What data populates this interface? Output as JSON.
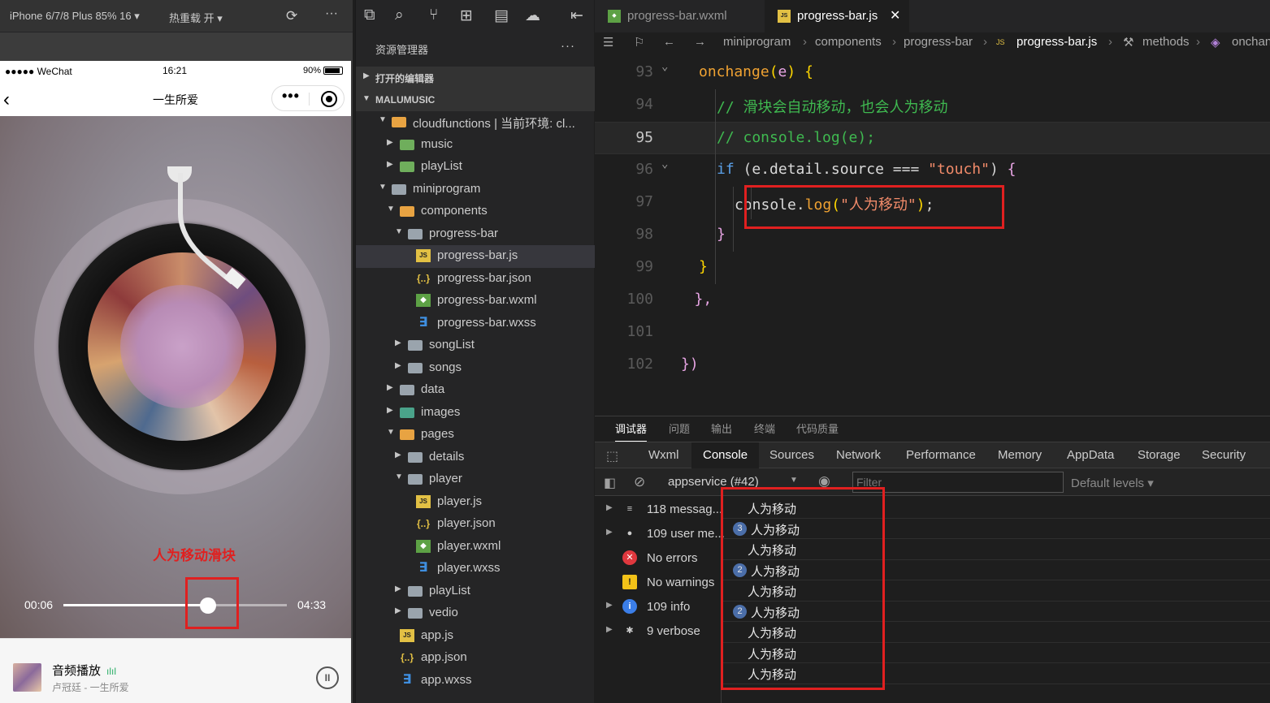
{
  "simulator": {
    "device": "iPhone 6/7/8 Plus 85% 16 ▾",
    "hot_reload": "热重载 开 ▾",
    "refresh_icon": "refresh-icon",
    "more_icon": "···",
    "status": {
      "signal": "●●●●● WeChat",
      "time": "16:21",
      "battery": "90%"
    },
    "nav": {
      "back": "‹",
      "title": "一生所爱",
      "more": "•••"
    },
    "player": {
      "drag_label": "人为移动滑块",
      "current_time": "00:06",
      "total_time": "04:33",
      "progress": 0.67
    },
    "controls": {
      "prev": "⏮",
      "next": "⏭",
      "list": "☰"
    },
    "mini": {
      "title": "音频播放",
      "eq": "ılıl",
      "subtitle": "卢冠廷 - 一生所爱",
      "pause": "II"
    }
  },
  "explorer": {
    "title": "资源管理器",
    "more": "···",
    "open_editors": "打开的编辑器",
    "project": "MALUMUSIC",
    "tree": [
      {
        "label": "cloudfunctions | 当前环境: cl...",
        "depth": 1,
        "arrow": "open",
        "icon": "folder-orange"
      },
      {
        "label": "music",
        "depth": 2,
        "arrow": "closed",
        "icon": "folder-green"
      },
      {
        "label": "playList",
        "depth": 2,
        "arrow": "closed",
        "icon": "folder-green"
      },
      {
        "label": "miniprogram",
        "depth": 1,
        "arrow": "open",
        "icon": "folder"
      },
      {
        "label": "components",
        "depth": 2,
        "arrow": "open",
        "icon": "folder-orange"
      },
      {
        "label": "progress-bar",
        "depth": 3,
        "arrow": "open",
        "icon": "folder"
      },
      {
        "label": "progress-bar.js",
        "depth": 4,
        "arrow": "",
        "icon": "js",
        "selected": true
      },
      {
        "label": "progress-bar.json",
        "depth": 4,
        "arrow": "",
        "icon": "json"
      },
      {
        "label": "progress-bar.wxml",
        "depth": 4,
        "arrow": "",
        "icon": "wxml"
      },
      {
        "label": "progress-bar.wxss",
        "depth": 4,
        "arrow": "",
        "icon": "wxss"
      },
      {
        "label": "songList",
        "depth": 3,
        "arrow": "closed",
        "icon": "folder"
      },
      {
        "label": "songs",
        "depth": 3,
        "arrow": "closed",
        "icon": "folder"
      },
      {
        "label": "data",
        "depth": 2,
        "arrow": "closed",
        "icon": "folder"
      },
      {
        "label": "images",
        "depth": 2,
        "arrow": "closed",
        "icon": "folder-teal"
      },
      {
        "label": "pages",
        "depth": 2,
        "arrow": "open",
        "icon": "folder-orange"
      },
      {
        "label": "details",
        "depth": 3,
        "arrow": "closed",
        "icon": "folder"
      },
      {
        "label": "player",
        "depth": 3,
        "arrow": "open",
        "icon": "folder"
      },
      {
        "label": "player.js",
        "depth": 4,
        "arrow": "",
        "icon": "js"
      },
      {
        "label": "player.json",
        "depth": 4,
        "arrow": "",
        "icon": "json"
      },
      {
        "label": "player.wxml",
        "depth": 4,
        "arrow": "",
        "icon": "wxml"
      },
      {
        "label": "player.wxss",
        "depth": 4,
        "arrow": "",
        "icon": "wxss"
      },
      {
        "label": "playList",
        "depth": 3,
        "arrow": "closed",
        "icon": "folder"
      },
      {
        "label": "vedio",
        "depth": 3,
        "arrow": "closed",
        "icon": "folder"
      },
      {
        "label": "app.js",
        "depth": 2,
        "arrow": "",
        "icon": "js"
      },
      {
        "label": "app.json",
        "depth": 2,
        "arrow": "",
        "icon": "json"
      },
      {
        "label": "app.wxss",
        "depth": 2,
        "arrow": "",
        "icon": "wxss"
      }
    ]
  },
  "editor": {
    "tabs": [
      {
        "label": "progress-bar.wxml",
        "icon": "wxml",
        "active": false
      },
      {
        "label": "progress-bar.js",
        "icon": "js",
        "active": true
      }
    ],
    "tab_close": "✕",
    "breadcrumbs": [
      "miniprogram",
      "components",
      "progress-bar",
      "progress-bar.js",
      "methods",
      "onchan"
    ],
    "lines": [
      {
        "n": "93",
        "fold": "⌄",
        "tokens": [
          [
            "c-fn",
            "onchange"
          ],
          [
            "c-punc",
            "("
          ],
          [
            "c-par",
            "e"
          ],
          [
            "c-punc",
            ")"
          ],
          [
            "c-plain",
            " "
          ],
          [
            "c-punc",
            "{"
          ]
        ],
        "indent": 1
      },
      {
        "n": "94",
        "tokens": [
          [
            "c-cm",
            "// 滑块会自动移动，也会人为移动"
          ]
        ],
        "indent": 2
      },
      {
        "n": "95",
        "current": true,
        "tokens": [
          [
            "c-cm",
            "// console.log(e);"
          ]
        ],
        "indent": 2
      },
      {
        "n": "96",
        "fold": "⌄",
        "tokens": [
          [
            "c-kw",
            "if"
          ],
          [
            "c-plain",
            " ("
          ],
          [
            "c-id",
            "e.detail.source"
          ],
          [
            "c-plain",
            " === "
          ],
          [
            "c-str",
            "\"touch\""
          ],
          [
            "c-plain",
            ") "
          ],
          [
            "c-par",
            "{"
          ]
        ],
        "indent": 2
      },
      {
        "n": "97",
        "tokens": [
          [
            "c-id",
            "console"
          ],
          [
            "c-plain",
            "."
          ],
          [
            "c-fn",
            "log"
          ],
          [
            "c-punc",
            "("
          ],
          [
            "c-str",
            "\"人为移动\""
          ],
          [
            "c-punc",
            ")"
          ],
          [
            "c-plain",
            ";"
          ]
        ],
        "indent": 3
      },
      {
        "n": "98",
        "tokens": [
          [
            "c-par",
            "}"
          ]
        ],
        "indent": 2
      },
      {
        "n": "99",
        "tokens": [
          [
            "c-punc",
            "}"
          ]
        ],
        "indent": 1
      },
      {
        "n": "100",
        "tokens": [
          [
            "c-par",
            "},"
          ]
        ],
        "indent": 0.75
      },
      {
        "n": "101",
        "tokens": [],
        "indent": 0
      },
      {
        "n": "102",
        "tokens": [
          [
            "c-par",
            "})"
          ]
        ],
        "indent": 0
      }
    ]
  },
  "debug": {
    "panel_tabs": [
      "调试器",
      "问题",
      "输出",
      "终端",
      "代码质量"
    ],
    "dev_tabs": [
      "Wxml",
      "Console",
      "Sources",
      "Network",
      "Performance",
      "Memory",
      "AppData",
      "Storage",
      "Security"
    ],
    "context": "appservice (#42)",
    "filter_placeholder": "Filter",
    "levels": "Default levels ▾",
    "sidebar": [
      {
        "label": "118 messag...",
        "icon": "≡",
        "arrow": true,
        "color": "#cccccc"
      },
      {
        "label": "109 user me...",
        "icon": "●",
        "arrow": true,
        "color": "#cccccc"
      },
      {
        "label": "No errors",
        "icon": "✕",
        "arrow": false,
        "color": "#e0383e"
      },
      {
        "label": "No warnings",
        "icon": "!",
        "arrow": false,
        "color": "#f2c218"
      },
      {
        "label": "109 info",
        "icon": "i",
        "arrow": true,
        "color": "#3b7ee8"
      },
      {
        "label": "9 verbose",
        "icon": "✱",
        "arrow": true,
        "color": "#cccccc"
      }
    ],
    "logs": [
      {
        "count": "",
        "text": "人为移动"
      },
      {
        "count": "3",
        "text": "人为移动"
      },
      {
        "count": "",
        "text": "人为移动"
      },
      {
        "count": "2",
        "text": "人为移动"
      },
      {
        "count": "",
        "text": "人为移动"
      },
      {
        "count": "2",
        "text": "人为移动"
      },
      {
        "count": "",
        "text": "人为移动"
      },
      {
        "count": "",
        "text": "人为移动"
      },
      {
        "count": "",
        "text": "人为移动"
      }
    ]
  }
}
